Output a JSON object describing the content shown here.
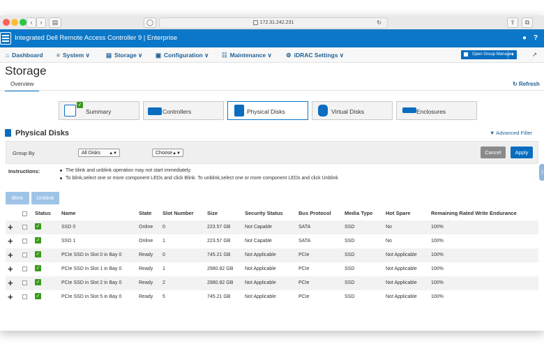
{
  "browser": {
    "url": "172.31.242.231",
    "colors": {
      "close": "#fe5f57",
      "minimize": "#febc2e",
      "zoom": "#28c840"
    }
  },
  "header": {
    "title": "Integrated Dell Remote Access Controller 9 | Enterprise",
    "user_icon": "user-icon",
    "help_icon": "help-icon",
    "help_label": "?"
  },
  "nav": {
    "items": [
      {
        "label": "Dashboard",
        "icon": "home-icon",
        "glyph": "⌂"
      },
      {
        "label": "System ∨",
        "icon": "system-icon",
        "glyph": "≡"
      },
      {
        "label": "Storage ∨",
        "icon": "storage-icon",
        "glyph": "▤"
      },
      {
        "label": "Configuration ∨",
        "icon": "configuration-icon",
        "glyph": "▣"
      },
      {
        "label": "Maintenance ∨",
        "icon": "maintenance-icon",
        "glyph": "☷"
      },
      {
        "label": "iDRAC Settings ∨",
        "icon": "settings-icon",
        "glyph": "⚙"
      }
    ],
    "group_manager": "Open Group Manager"
  },
  "page": {
    "title": "Storage",
    "tab": "Overview",
    "refresh": "Refresh",
    "tiles": [
      "Summary",
      "Controllers",
      "Physical Disks",
      "Virtual Disks",
      "Enclosures"
    ],
    "active_tile": "Physical Disks",
    "section_title": "Physical Disks",
    "advanced_filter": "Advanced Filter"
  },
  "filter": {
    "group_by_label": "Group By",
    "group_by_value": "All Disks",
    "choose_value": "Choose",
    "cancel": "Cancel",
    "apply": "Apply"
  },
  "instructions": {
    "label": "Instructions:",
    "lines": [
      "The blink and unblink operation may not start immediately.",
      "To blink,select one or more component LEDs and click Blink. To unblink,select one or more component LEDs and click Unblink"
    ]
  },
  "actions": {
    "blink": "Blink",
    "unblink": "Unblink"
  },
  "table": {
    "headers": [
      "Status",
      "Name",
      "State",
      "Slot Number",
      "Size",
      "Security Status",
      "Bus Protocol",
      "Media Type",
      "Hot Spare",
      "Remaining Rated Write Endurance"
    ],
    "rows": [
      {
        "name": "SSD 0",
        "state": "Online",
        "slot": "0",
        "size": "223.57 GB",
        "security": "Not Capable",
        "bus": "SATA",
        "media": "SSD",
        "hotspare": "No",
        "endurance": "100%"
      },
      {
        "name": "SSD 1",
        "state": "Online",
        "slot": "1",
        "size": "223.57 GB",
        "security": "Not Capable",
        "bus": "SATA",
        "media": "SSD",
        "hotspare": "No",
        "endurance": "100%"
      },
      {
        "name": "PCIe SSD in Slot 0 in Bay 0",
        "state": "Ready",
        "slot": "0",
        "size": "745.21 GB",
        "security": "Not Applicable",
        "bus": "PCIe",
        "media": "SSD",
        "hotspare": "Not Applicable",
        "endurance": "100%"
      },
      {
        "name": "PCIe SSD in Slot 1 in Bay 0",
        "state": "Ready",
        "slot": "1",
        "size": "2980.82 GB",
        "security": "Not Applicable",
        "bus": "PCIe",
        "media": "SSD",
        "hotspare": "Not Applicable",
        "endurance": "100%"
      },
      {
        "name": "PCIe SSD in Slot 2 in Bay 0",
        "state": "Ready",
        "slot": "2",
        "size": "2980.82 GB",
        "security": "Not Applicable",
        "bus": "PCIe",
        "media": "SSD",
        "hotspare": "Not Applicable",
        "endurance": "100%"
      },
      {
        "name": "PCIe SSD in Slot 5 in Bay 0",
        "state": "Ready",
        "slot": "5",
        "size": "745.21 GB",
        "security": "Not Applicable",
        "bus": "PCIe",
        "media": "SSD",
        "hotspare": "Not Applicable",
        "endurance": "100%"
      }
    ]
  },
  "colors": {
    "brand": "#0a77c8",
    "ok": "#3a9a1b"
  }
}
